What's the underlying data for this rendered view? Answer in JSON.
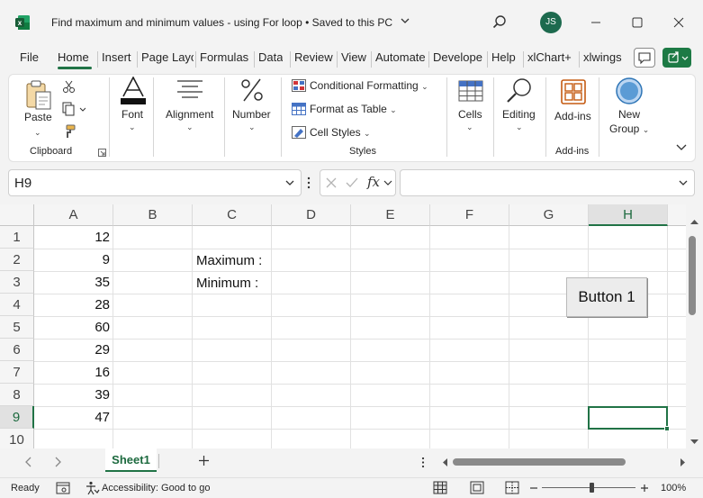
{
  "window": {
    "title": "Find maximum and minimum values - using For loop",
    "save_status": "Saved to this PC",
    "user_initials": "JS"
  },
  "tabs": [
    "File",
    "Home",
    "Insert",
    "Page Layo",
    "Formulas",
    "Data",
    "Review",
    "View",
    "Automate",
    "Develope",
    "Help",
    "xlChart+",
    "xlwings"
  ],
  "ribbon": {
    "clipboard": {
      "paste": "Paste",
      "group": "Clipboard"
    },
    "font": "Font",
    "alignment": "Alignment",
    "number": "Number",
    "styles": {
      "conditional_formatting": "Conditional Formatting",
      "format_as_table": "Format as Table",
      "cell_styles": "Cell Styles",
      "group": "Styles"
    },
    "cells": "Cells",
    "editing": "Editing",
    "addins": {
      "label": "Add-ins",
      "group": "Add-ins"
    },
    "new_group": {
      "line1": "New",
      "line2": "Group"
    }
  },
  "formula_bar": {
    "name_box": "H9",
    "formula": ""
  },
  "grid": {
    "columns": [
      "A",
      "B",
      "C",
      "D",
      "E",
      "F",
      "G",
      "H"
    ],
    "rows": [
      "1",
      "2",
      "3",
      "4",
      "5",
      "6",
      "7",
      "8",
      "9",
      "10"
    ],
    "selected_column": "H",
    "selected_row": "9",
    "column_a_values": [
      "12",
      "9",
      "35",
      "28",
      "60",
      "29",
      "16",
      "39",
      "47"
    ],
    "labels": {
      "maximum": "Maximum :",
      "minimum": "Minimum :"
    },
    "form_button": "Button 1"
  },
  "sheets": [
    "Sheet1"
  ],
  "status": {
    "ready": "Ready",
    "accessibility": "Accessibility: Good to go",
    "zoom": "100%"
  },
  "colors": {
    "accent": "#217346",
    "avatar": "#1d6a4e"
  }
}
